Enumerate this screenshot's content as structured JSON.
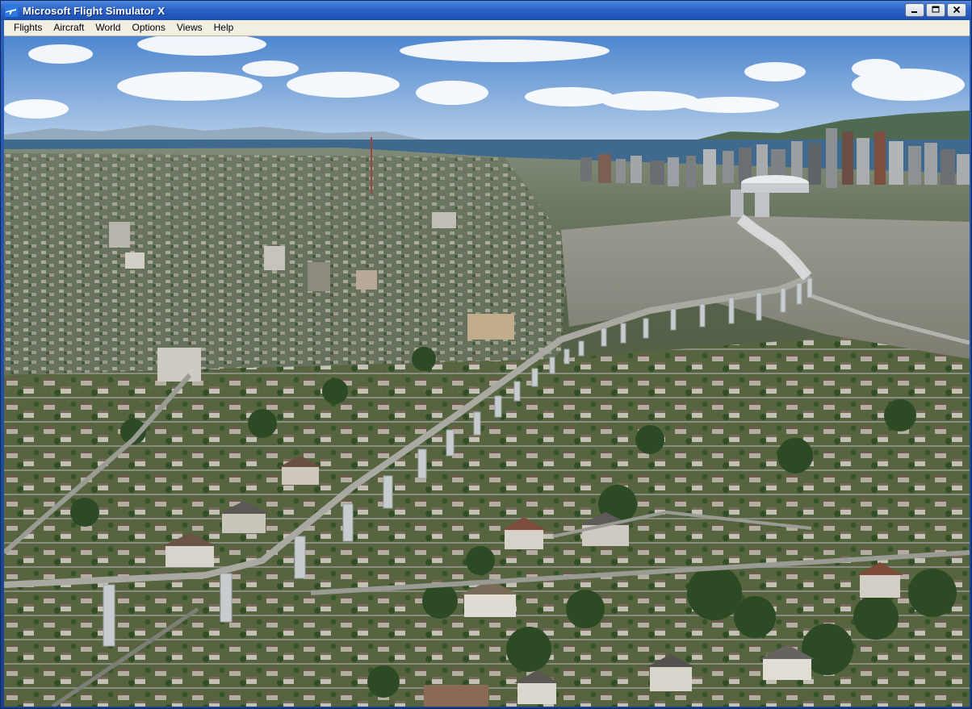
{
  "window": {
    "title": "Microsoft Flight Simulator X",
    "app_icon": "airplane-icon",
    "controls": [
      "minimize-icon",
      "maximize-icon",
      "close-icon"
    ]
  },
  "menu": {
    "items": [
      {
        "label": "Flights"
      },
      {
        "label": "Aircraft"
      },
      {
        "label": "World"
      },
      {
        "label": "Options"
      },
      {
        "label": "Views"
      },
      {
        "label": "Help"
      }
    ]
  },
  "scene": {
    "colors": {
      "sky_top": "#4d86cf",
      "sky_bottom": "#bcd3ea",
      "water": "#3f6a8e",
      "ground": "#5d6b4a",
      "airfield": "#8a8a7e",
      "monorail": "#a9a9a2"
    }
  }
}
